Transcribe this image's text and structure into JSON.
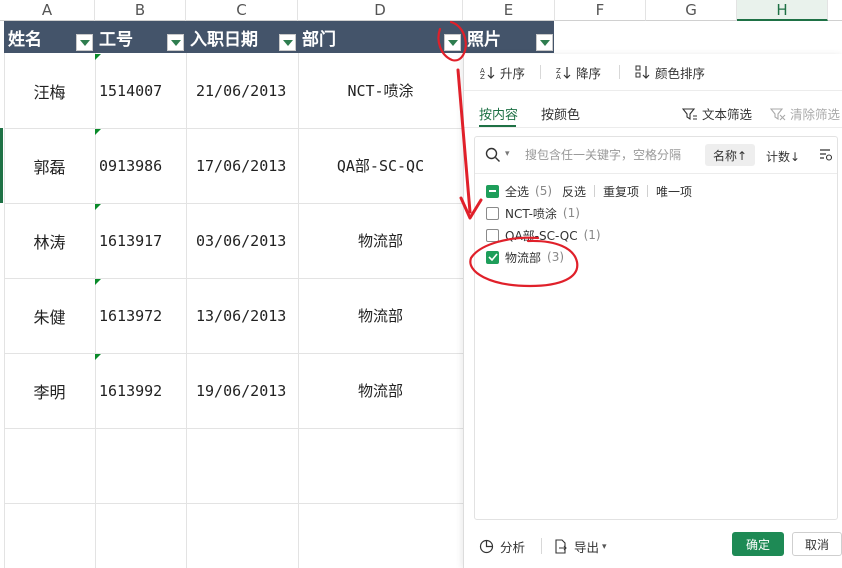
{
  "columns": [
    "A",
    "B",
    "C",
    "D",
    "E",
    "F",
    "G",
    "H"
  ],
  "headers": [
    "姓名",
    "工号",
    "入职日期",
    "部门",
    "照片"
  ],
  "rows": [
    {
      "name": "汪梅",
      "id": "1514007",
      "date": "21/06/2013",
      "dept": "NCT-喷涂"
    },
    {
      "name": "郭磊",
      "id": "0913986",
      "date": "17/06/2013",
      "dept": "QA部-SC-QC"
    },
    {
      "name": "林涛",
      "id": "1613917",
      "date": "03/06/2013",
      "dept": "物流部"
    },
    {
      "name": "朱健",
      "id": "1613972",
      "date": "13/06/2013",
      "dept": "物流部"
    },
    {
      "name": "李明",
      "id": "1613992",
      "date": "19/06/2013",
      "dept": "物流部"
    }
  ],
  "filter_panel": {
    "toolbar": {
      "sort_asc": "升序",
      "sort_desc": "降序",
      "color_sort": "颜色排序"
    },
    "tabs": [
      {
        "label": "按内容",
        "active": true
      },
      {
        "label": "按颜色",
        "active": false
      }
    ],
    "text_filter": "文本筛选",
    "clear_filter": "清除筛选",
    "search": {
      "placeholder": "搜包含任一关键字，空格分隔"
    },
    "sort_name": "名称↑",
    "sort_count": "计数↓",
    "select_all": {
      "label": "全选",
      "count": "(5)",
      "state": "partial"
    },
    "links": [
      "反选",
      "重复项",
      "唯一项"
    ],
    "items": [
      {
        "label": "NCT-喷涂",
        "count": "(1)",
        "checked": false
      },
      {
        "label": "QA部-SC-QC",
        "count": "(1)",
        "checked": false
      },
      {
        "label": "物流部",
        "count": "(3)",
        "checked": true
      }
    ],
    "footer": {
      "analyze": "分析",
      "export": "导出",
      "ok": "确定",
      "cancel": "取消"
    }
  },
  "colors": {
    "header_bg": "#44546a",
    "accent": "#1e7145",
    "ok_button": "#1e8a55",
    "annotation": "#e0202a"
  }
}
